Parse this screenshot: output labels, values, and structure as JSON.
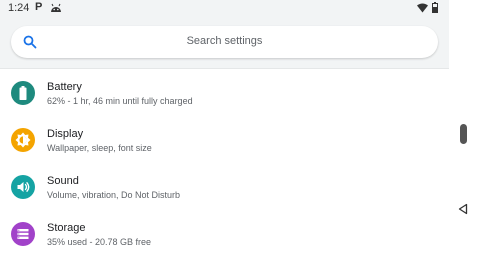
{
  "status_bar": {
    "time": "1:24",
    "notification_letter": "P",
    "icons": [
      "p-icon",
      "android-icon",
      "wifi-icon",
      "battery-icon"
    ]
  },
  "search": {
    "placeholder": "Search settings",
    "icon": "search-icon"
  },
  "settings_items": [
    {
      "title": "Battery",
      "subtitle": "62% - 1 hr, 46 min until fully charged",
      "icon": "battery-full-icon",
      "color": "#1e8a7e"
    },
    {
      "title": "Display",
      "subtitle": "Wallpaper, sleep, font size",
      "icon": "brightness-icon",
      "color": "#f4a400"
    },
    {
      "title": "Sound",
      "subtitle": "Volume, vibration, Do Not Disturb",
      "icon": "volume-icon",
      "color": "#15a3a3"
    },
    {
      "title": "Storage",
      "subtitle": "35% used - 20.78 GB free",
      "icon": "storage-icon",
      "color": "#a142c9"
    }
  ],
  "navigation": {
    "back": "back-icon"
  },
  "colors": {
    "background": "#f2f4f5",
    "accent": "#1a73e8"
  }
}
